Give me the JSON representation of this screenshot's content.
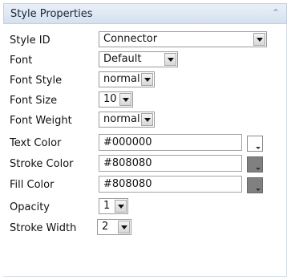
{
  "panel": {
    "title": "Style Properties",
    "collapse_icon": "chevron-up-icon"
  },
  "fields": {
    "style_id": {
      "label": "Style ID",
      "value": "Connector"
    },
    "font": {
      "label": "Font",
      "value": "Default"
    },
    "font_style": {
      "label": "Font Style",
      "value": "normal"
    },
    "font_size": {
      "label": "Font Size",
      "value": "10"
    },
    "font_weight": {
      "label": "Font Weight",
      "value": "normal"
    },
    "text_color": {
      "label": "Text Color",
      "value": "#000000",
      "swatch": "#ffffff"
    },
    "stroke_color": {
      "label": "Stroke Color",
      "value": "#808080",
      "swatch": "#808080"
    },
    "fill_color": {
      "label": "Fill Color",
      "value": "#808080",
      "swatch": "#808080"
    },
    "opacity": {
      "label": "Opacity",
      "value": "1"
    },
    "stroke_width": {
      "label": "Stroke Width",
      "value": "2"
    }
  }
}
